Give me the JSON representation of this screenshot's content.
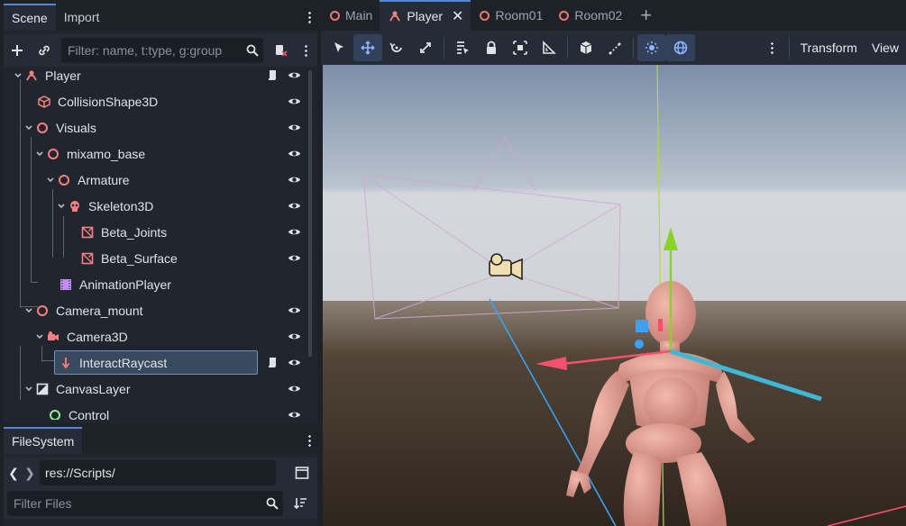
{
  "scene_dock": {
    "tabs": [
      "Scene",
      "Import"
    ],
    "filter_placeholder": "Filter: name, t:type, g:group",
    "tree": [
      {
        "label": "Player",
        "depth": 0,
        "expanded": true,
        "icon": "player-node-icon",
        "script": true
      },
      {
        "label": "CollisionShape3D",
        "depth": 1,
        "expanded": null,
        "icon": "collision-shape-icon"
      },
      {
        "label": "Visuals",
        "depth": 1,
        "expanded": true,
        "icon": "node3d-icon"
      },
      {
        "label": "mixamo_base",
        "depth": 2,
        "expanded": true,
        "icon": "node3d-icon"
      },
      {
        "label": "Armature",
        "depth": 3,
        "expanded": true,
        "icon": "node3d-icon"
      },
      {
        "label": "Skeleton3D",
        "depth": 4,
        "expanded": true,
        "icon": "skeleton-icon"
      },
      {
        "label": "Beta_Joints",
        "depth": 5,
        "expanded": null,
        "icon": "mesh-instance-icon"
      },
      {
        "label": "Beta_Surface",
        "depth": 5,
        "expanded": null,
        "icon": "mesh-instance-icon"
      },
      {
        "label": "AnimationPlayer",
        "depth": 3,
        "expanded": null,
        "icon": "animation-player-icon"
      },
      {
        "label": "Camera_mount",
        "depth": 1,
        "expanded": true,
        "icon": "node3d-icon"
      },
      {
        "label": "Camera3D",
        "depth": 2,
        "expanded": true,
        "icon": "camera-icon"
      },
      {
        "label": "InteractRaycast",
        "depth": 3,
        "expanded": null,
        "icon": "raycast-icon",
        "selected": true,
        "script": true
      },
      {
        "label": "CanvasLayer",
        "depth": 1,
        "expanded": true,
        "icon": "canvas-layer-icon"
      },
      {
        "label": "Control",
        "depth": 2,
        "expanded": null,
        "icon": "control-icon"
      }
    ]
  },
  "filesystem_dock": {
    "tab": "FileSystem",
    "path": "res://Scripts/",
    "filter_placeholder": "Filter Files"
  },
  "editor": {
    "tabs": [
      {
        "label": "Main",
        "active": false
      },
      {
        "label": "Player",
        "active": true
      },
      {
        "label": "Room01",
        "active": false
      },
      {
        "label": "Room02",
        "active": false
      }
    ],
    "menus": [
      "Transform",
      "View"
    ]
  },
  "colors": {
    "accent": "#5586d1",
    "node3d": "#fc7f7f",
    "control": "#8eef97",
    "axis_x": "#f5506e",
    "axis_y": "#8bd12b",
    "axis_z": "#3ba1f5"
  }
}
